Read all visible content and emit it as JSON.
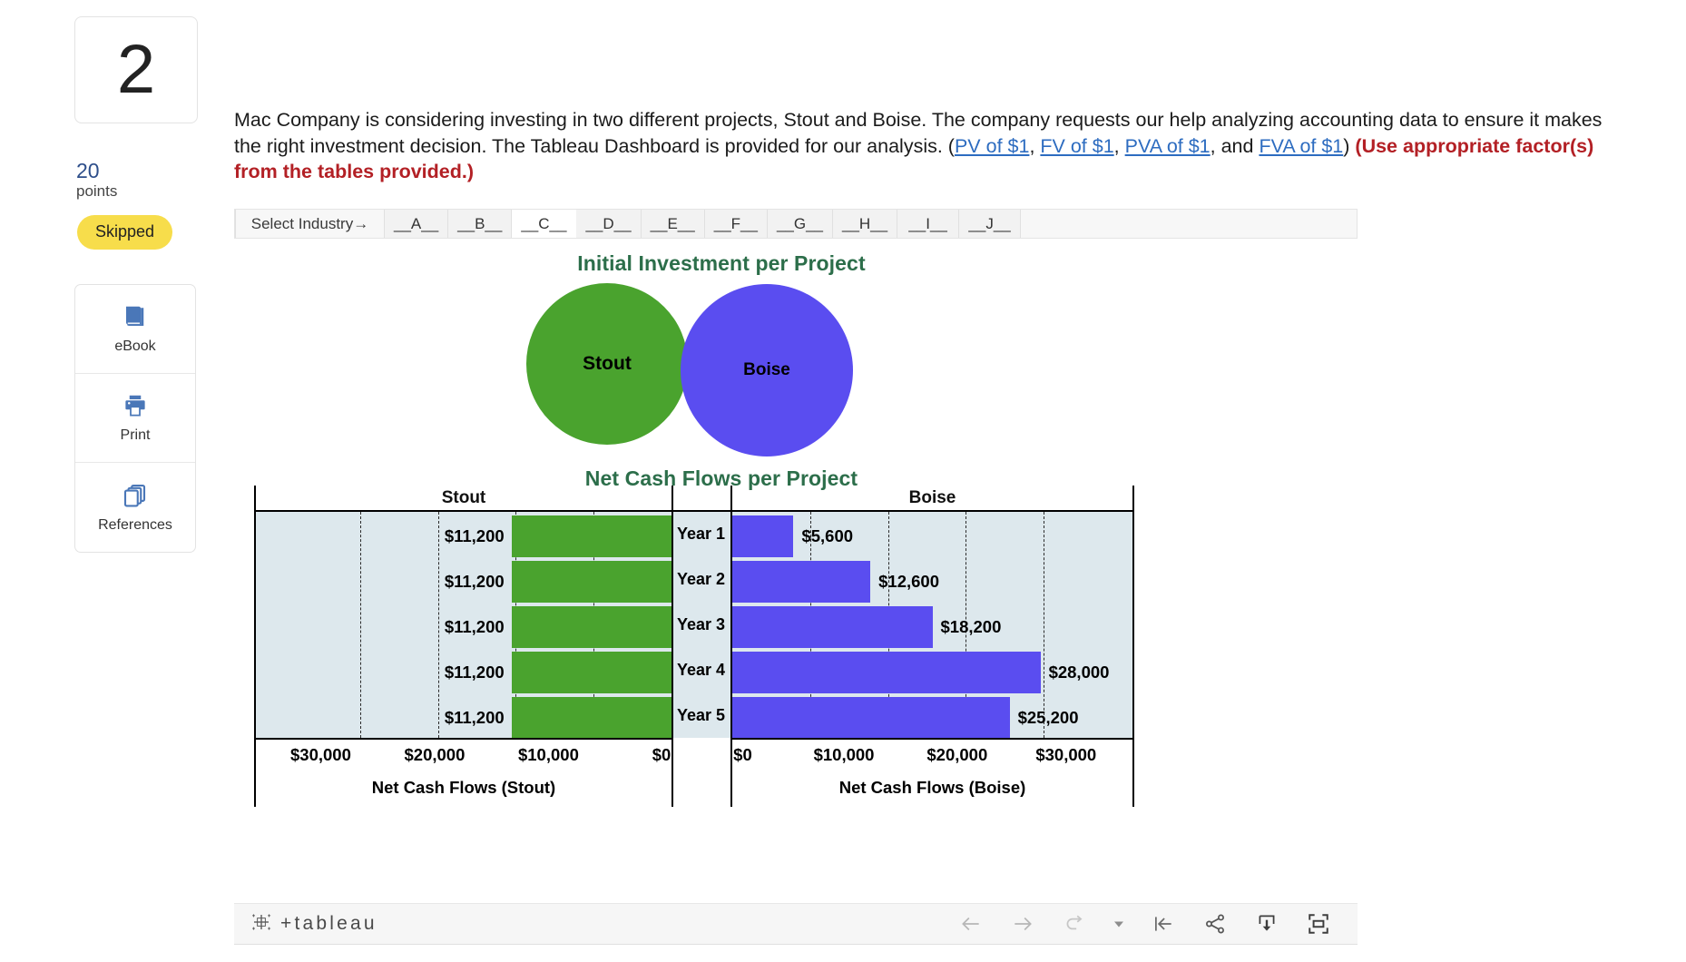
{
  "question": {
    "number": "2",
    "points_value": "20",
    "points_label": "points",
    "status_badge": "Skipped"
  },
  "tools": [
    {
      "label": "eBook",
      "icon": "book-icon"
    },
    {
      "label": "Print",
      "icon": "printer-icon"
    },
    {
      "label": "References",
      "icon": "copy-pages-icon"
    }
  ],
  "prompt": {
    "part1": "Mac Company is considering investing in two different projects, Stout and Boise. The company requests our help analyzing accounting data to ensure it makes the right investment decision. The Tableau Dashboard is provided for our analysis. (",
    "link1": "PV of $1",
    "sep1": ", ",
    "link2": "FV of $1",
    "sep2": ", ",
    "link3": "PVA of $1",
    "sep3": ", and ",
    "link4": "FVA of $1",
    "close_paren": ") ",
    "hint": "(Use appropriate factor(s) from the tables provided.)"
  },
  "dashboard": {
    "filter_strip": {
      "lead_label": "Select Industry→",
      "tabs": [
        {
          "label": "__A__",
          "active": false
        },
        {
          "label": "__B__",
          "active": false
        },
        {
          "label": "__C__",
          "active": true
        },
        {
          "label": "__D__",
          "active": false
        },
        {
          "label": "__E__",
          "active": false
        },
        {
          "label": "__F__",
          "active": false
        },
        {
          "label": "__G__",
          "active": false
        },
        {
          "label": "__H__",
          "active": false
        },
        {
          "label": "__I__",
          "active": false
        },
        {
          "label": "__J__",
          "active": false
        }
      ]
    },
    "investment_title": "Initial Investment per Project",
    "bubbles": [
      {
        "label": "Stout",
        "color": "#4aa32e"
      },
      {
        "label": "Boise",
        "color": "#5a4df0"
      }
    ],
    "flows_title": "Net Cash Flows per Project",
    "footer": {
      "brand": "tableau",
      "brand_plus": "+",
      "actions": [
        {
          "name": "back-arrow-icon"
        },
        {
          "name": "forward-arrow-icon"
        },
        {
          "name": "revert-icon"
        },
        {
          "name": "revert-dropdown-caret-icon"
        },
        {
          "name": "reset-icon"
        },
        {
          "name": "share-icon"
        },
        {
          "name": "download-icon"
        },
        {
          "name": "fullscreen-icon"
        }
      ]
    }
  },
  "chart_data": {
    "type": "bar",
    "title": "Net Cash Flows per Project",
    "orientation": "horizontal",
    "layout": "butterfly/diverging two-panel",
    "categories": [
      "Year 1",
      "Year 2",
      "Year 3",
      "Year 4",
      "Year 5"
    ],
    "series": [
      {
        "name": "Stout",
        "panel": "left",
        "color": "#4aa32e",
        "axis_label": "Net Cash Flows (Stout)",
        "direction": "right-to-left",
        "values": [
          11200,
          11200,
          11200,
          11200,
          11200
        ],
        "value_labels": [
          "$11,200",
          "$11,200",
          "$11,200",
          "$11,200",
          "$11,200"
        ],
        "ticks": [
          "$30,000",
          "$20,000",
          "$10,000",
          "$0"
        ],
        "tick_values": [
          30000,
          20000,
          10000,
          0
        ],
        "axis_range": [
          0,
          35000
        ]
      },
      {
        "name": "Boise",
        "panel": "right",
        "color": "#5a4df0",
        "axis_label": "Net Cash Flows (Boise)",
        "direction": "left-to-right",
        "values": [
          5600,
          12600,
          18200,
          28000,
          25200
        ],
        "value_labels": [
          "$5,600",
          "$12,600",
          "$18,200",
          "$28,000",
          "$25,200"
        ],
        "ticks": [
          "$0",
          "$10,000",
          "$20,000",
          "$30,000"
        ],
        "tick_values": [
          0,
          10000,
          20000,
          30000
        ],
        "axis_range": [
          0,
          35000
        ]
      }
    ],
    "panel_headers": [
      "Stout",
      "Boise"
    ],
    "plot_background": "#dde8ed",
    "grid": "dashed vertical gridlines",
    "legend": "none"
  }
}
